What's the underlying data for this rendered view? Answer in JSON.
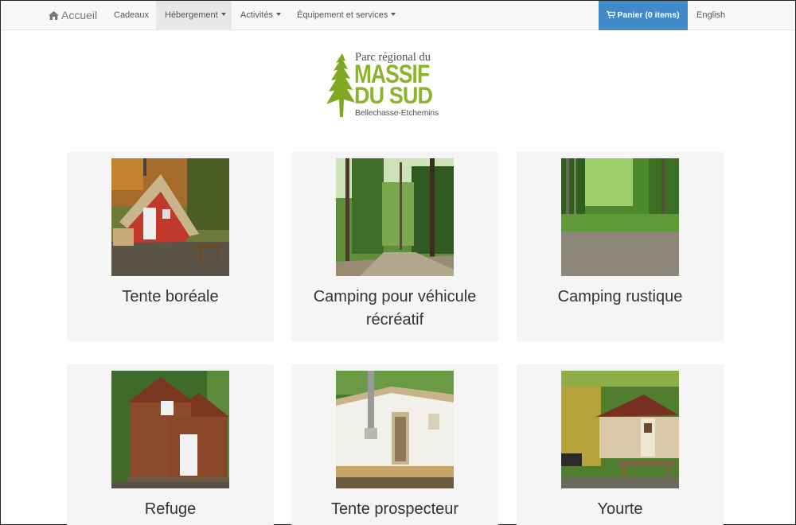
{
  "navbar": {
    "home_label": "Accueil",
    "gifts_label": "Cadeaux",
    "lodging_label": "Hébergement",
    "activities_label": "Activités",
    "equipment_label": "Équipement et services",
    "cart_label": "Panier (0 items)",
    "language_label": "English"
  },
  "logo": {
    "line1": "Parc régional du",
    "massif": "MASSIF",
    "du_sud": "DU SUD",
    "tagline": "Bellechasse-Etchemins",
    "brand_color": "#8ab52a"
  },
  "cards": [
    {
      "title": "Tente boréale",
      "image": "red-wall-tent-photo"
    },
    {
      "title": "Camping pour véhicule récréatif",
      "image": "forest-road-photo"
    },
    {
      "title": "Camping rustique",
      "image": "forest-clearing-photo"
    },
    {
      "title": "Refuge",
      "image": "wooden-cabin-photo"
    },
    {
      "title": "Tente prospecteur",
      "image": "white-prospector-tent-photo"
    },
    {
      "title": "Yourte",
      "image": "yurt-photo"
    }
  ],
  "colors": {
    "cart_background": "#428bca",
    "active_nav_background": "#e7e7e7",
    "card_background": "#f5f5f5"
  }
}
